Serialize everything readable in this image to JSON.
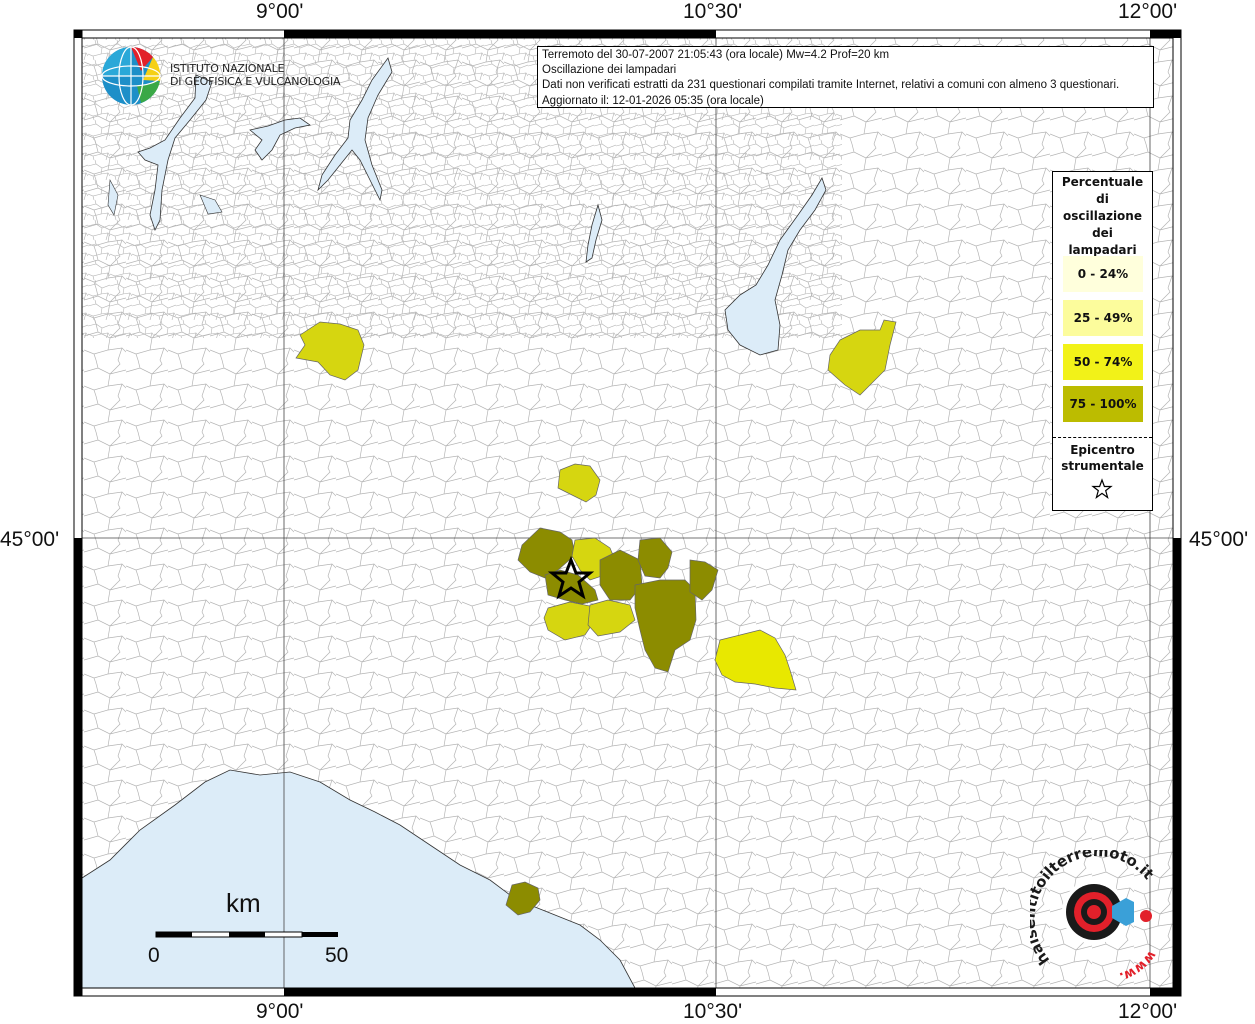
{
  "coords": {
    "top": [
      "9°00'",
      "10°30'",
      "12°00'"
    ],
    "bottom": [
      "9°00'",
      "10°30'",
      "12°00'"
    ],
    "left": "45°00'",
    "right": "45°00'"
  },
  "info": {
    "line1": "Terremoto del 30-07-2007 21:05:43 (ora locale) Mw=4.2 Prof=20 km",
    "line2": "Oscillazione dei lampadari",
    "line3": "Dati non verificati estratti da 231 questionari compilati tramite Internet, relativi a comuni con almeno 3 questionari.",
    "line4": "Aggiornato il: 12-01-2026 05:35 (ora locale)"
  },
  "institute": {
    "line1": "ISTITUTO NAZIONALE",
    "line2": "DI GEOFISICA E VULCANOLOGIA"
  },
  "legend": {
    "title": [
      "Percentuale",
      "di",
      "oscillazione",
      "dei",
      "lampadari"
    ],
    "classes": [
      {
        "label": "0 - 24%",
        "color": "#ffffdc"
      },
      {
        "label": "25 - 49%",
        "color": "#fcfc9c"
      },
      {
        "label": "50 - 74%",
        "color": "#f2f218"
      },
      {
        "label": "75 - 100%",
        "color": "#bcbc00"
      }
    ],
    "epicenter": [
      "Epicentro",
      "strumentale"
    ]
  },
  "scale": {
    "title": "km",
    "min": "0",
    "max": "50"
  },
  "logo": {
    "text": "haisentitoilterremoto.it",
    "url": "www."
  },
  "colors": {
    "sea": "#dcecf8",
    "border": "#aaaaaa",
    "c75": "#8c8c00",
    "c75b": "#bcbc00",
    "c50": "#e8e800",
    "c25": "#d6d610"
  }
}
